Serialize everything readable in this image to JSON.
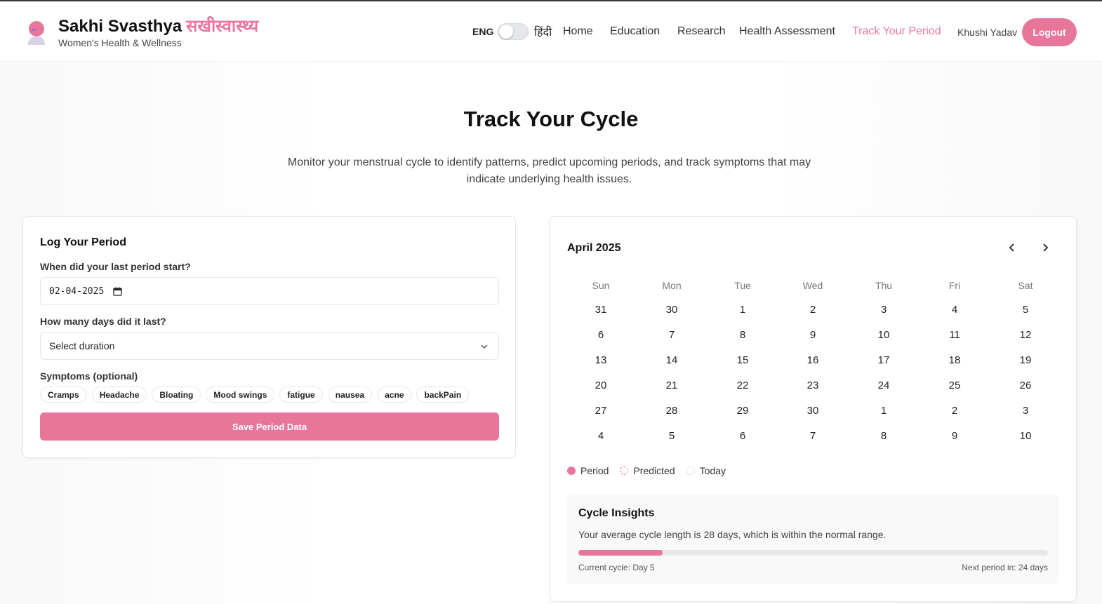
{
  "brand": {
    "title": "Sakhi Svasthya",
    "title_hindi": "सखीस्वास्थ्य",
    "subtitle": "Women's Health & Wellness",
    "accent_color": "#e8769a"
  },
  "language": {
    "left": "ENG",
    "right": "हिंदी",
    "hindi_enabled": false
  },
  "nav": {
    "items": [
      "Home",
      "Education",
      "Research",
      "Health Assessment",
      "Track Your Period"
    ],
    "active": "Track Your Period",
    "user": "Khushi Yadav",
    "logout": "Logout"
  },
  "hero": {
    "title": "Track Your Cycle",
    "description": "Monitor your menstrual cycle to identify patterns, predict upcoming periods, and track symptoms that may indicate underlying health issues."
  },
  "log_form": {
    "title": "Log Your Period",
    "start_label": "When did your last period start?",
    "start_value": "02-04-2025",
    "duration_label": "How many days did it last?",
    "duration_value": "Select duration",
    "symptoms_label": "Symptoms (optional)",
    "symptoms": [
      "Cramps",
      "Headache",
      "Bloating",
      "Mood swings",
      "fatigue",
      "nausea",
      "acne",
      "backPain"
    ],
    "save_label": "Save Period Data"
  },
  "calendar": {
    "month": "April 2025",
    "weekdays": [
      "Sun",
      "Mon",
      "Tue",
      "Wed",
      "Thu",
      "Fri",
      "Sat"
    ],
    "weeks": [
      [
        "31",
        "30",
        "1",
        "2",
        "3",
        "4",
        "5"
      ],
      [
        "6",
        "7",
        "8",
        "9",
        "10",
        "11",
        "12"
      ],
      [
        "13",
        "14",
        "15",
        "16",
        "17",
        "18",
        "19"
      ],
      [
        "20",
        "21",
        "22",
        "23",
        "24",
        "25",
        "26"
      ],
      [
        "27",
        "28",
        "29",
        "30",
        "1",
        "2",
        "3"
      ],
      [
        "4",
        "5",
        "6",
        "7",
        "8",
        "9",
        "10"
      ]
    ],
    "legend": {
      "period": "Period",
      "predicted": "Predicted",
      "today": "Today"
    }
  },
  "insights": {
    "title": "Cycle Insights",
    "text": "Your average cycle length is 28 days, which is within the normal range.",
    "progress_fraction": 0.18,
    "current": "Current cycle: Day 5",
    "next": "Next period in: 24 days"
  }
}
